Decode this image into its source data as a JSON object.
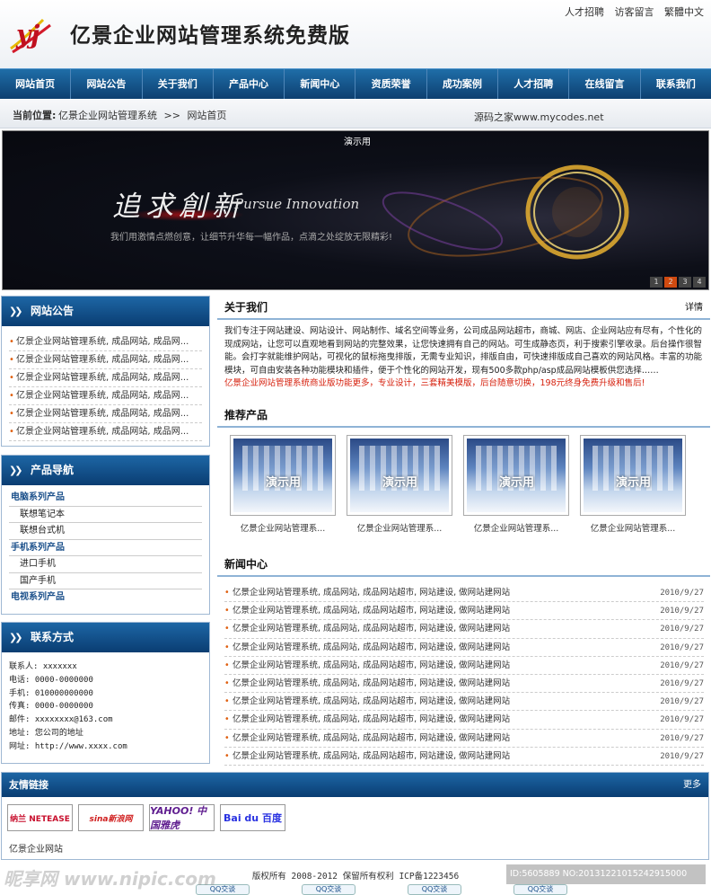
{
  "header": {
    "title": "亿景企业网站管理系统免费版",
    "top_links": [
      "人才招聘",
      "访客留言",
      "繁體中文"
    ]
  },
  "nav": [
    "网站首页",
    "网站公告",
    "关于我们",
    "产品中心",
    "新闻中心",
    "资质荣誉",
    "成功案例",
    "人才招聘",
    "在线留言",
    "联系我们"
  ],
  "breadcrumb": {
    "label": "当前位置:",
    "site": "亿景企业网站管理系统",
    "sep": ">>",
    "page": "网站首页",
    "mycodes": "源码之家www.mycodes.net"
  },
  "banner": {
    "demo": "演示用",
    "calligraphy": "追求創新",
    "english": "Pursue Innovation",
    "slogan": "我们用激情点燃创意，让细节升华每一幅作品，点滴之处绽放无限精彩!",
    "dots": [
      "1",
      "2",
      "3",
      "4"
    ],
    "active_dot": 1
  },
  "notice": {
    "title": "网站公告",
    "items": [
      "亿景企业网站管理系统, 成品网站, 成品网...",
      "亿景企业网站管理系统, 成品网站, 成品网...",
      "亿景企业网站管理系统, 成品网站, 成品网...",
      "亿景企业网站管理系统, 成品网站, 成品网...",
      "亿景企业网站管理系统, 成品网站, 成品网...",
      "亿景企业网站管理系统, 成品网站, 成品网..."
    ]
  },
  "products_nav": {
    "title": "产品导航",
    "items": [
      {
        "label": "电脑系列产品",
        "type": "cat"
      },
      {
        "label": "联想笔记本",
        "type": "sub"
      },
      {
        "label": "联想台式机",
        "type": "sub"
      },
      {
        "label": "手机系列产品",
        "type": "cat"
      },
      {
        "label": "进口手机",
        "type": "sub"
      },
      {
        "label": "国产手机",
        "type": "sub"
      },
      {
        "label": "电视系列产品",
        "type": "cat"
      }
    ]
  },
  "contact": {
    "title": "联系方式",
    "lines": [
      "联系人: xxxxxxx",
      "电话: 0000-0000000",
      "手机: 010000000000",
      "传真: 0000-0000000",
      "邮件: xxxxxxxx@163.com",
      "地址: 您公司的地址",
      "网址: http://www.xxxx.com"
    ]
  },
  "about": {
    "title": "关于我们",
    "more": "详情",
    "text": "我们专注于网站建设、网站设计、网站制作、域名空间等业务，公司成品网站超市，商城、网店、企业网站应有尽有，个性化的现成网站，让您可以直观地看到网站的完整效果，让您快速拥有自己的网站。可生成静态页，利于搜索引擎收录。后台操作很智能。会打字就能维护网站，可视化的鼠标拖曳排版，无需专业知识，排版自由，可快速排版成自己喜欢的网站风格。丰富的功能模块，可自由安装各种功能模块和插件，便于个性化的网站开发，现有500多款php/asp成品网站模板供您选择……",
    "highlight": "亿景企业网站管理系统商业版功能更多，专业设计，三套精美模版，后台随意切换，198元终身免费升级和售后!"
  },
  "recommend": {
    "title": "推荐产品",
    "watermark": "演示用",
    "items": [
      "亿景企业网站管理系...",
      "亿景企业网站管理系...",
      "亿景企业网站管理系...",
      "亿景企业网站管理系..."
    ]
  },
  "news": {
    "title": "新闻中心",
    "items": [
      {
        "title": "亿景企业网站管理系统, 成品网站, 成品网站超市, 网站建设, 做网站建网站",
        "date": "2010/9/27"
      },
      {
        "title": "亿景企业网站管理系统, 成品网站, 成品网站超市, 网站建设, 做网站建网站",
        "date": "2010/9/27"
      },
      {
        "title": "亿景企业网站管理系统, 成品网站, 成品网站超市, 网站建设, 做网站建网站",
        "date": "2010/9/27"
      },
      {
        "title": "亿景企业网站管理系统, 成品网站, 成品网站超市, 网站建设, 做网站建网站",
        "date": "2010/9/27"
      },
      {
        "title": "亿景企业网站管理系统, 成品网站, 成品网站超市, 网站建设, 做网站建网站",
        "date": "2010/9/27"
      },
      {
        "title": "亿景企业网站管理系统, 成品网站, 成品网站超市, 网站建设, 做网站建网站",
        "date": "2010/9/27"
      },
      {
        "title": "亿景企业网站管理系统, 成品网站, 成品网站超市, 网站建设, 做网站建网站",
        "date": "2010/9/27"
      },
      {
        "title": "亿景企业网站管理系统, 成品网站, 成品网站超市, 网站建设, 做网站建网站",
        "date": "2010/9/27"
      },
      {
        "title": "亿景企业网站管理系统, 成品网站, 成品网站超市, 网站建设, 做网站建网站",
        "date": "2010/9/27"
      },
      {
        "title": "亿景企业网站管理系统, 成品网站, 成品网站超市, 网站建设, 做网站建网站",
        "date": "2010/9/27"
      }
    ]
  },
  "friend_links": {
    "title": "友情链接",
    "more": "更多",
    "logos": [
      "纳兰 NETEASE",
      "sina新浪网",
      "YAHOO! 中国雅虎",
      "Bai du 百度"
    ],
    "text_link": "亿景企业网站"
  },
  "footer": {
    "copyright": "版权所有 2008-2012 保留所有权利 ICP备1223456",
    "qq": [
      "QQ交谈",
      "QQ交谈",
      "QQ交谈",
      "QQ交谈"
    ]
  },
  "watermark": {
    "left": "昵享网 www.nipic.com",
    "id": "ID:5605889 NO:20131221015242915000"
  },
  "colors": {
    "nav_blue": "#0d3f70",
    "accent_orange": "#e06010",
    "highlight_red": "#d6200d"
  }
}
